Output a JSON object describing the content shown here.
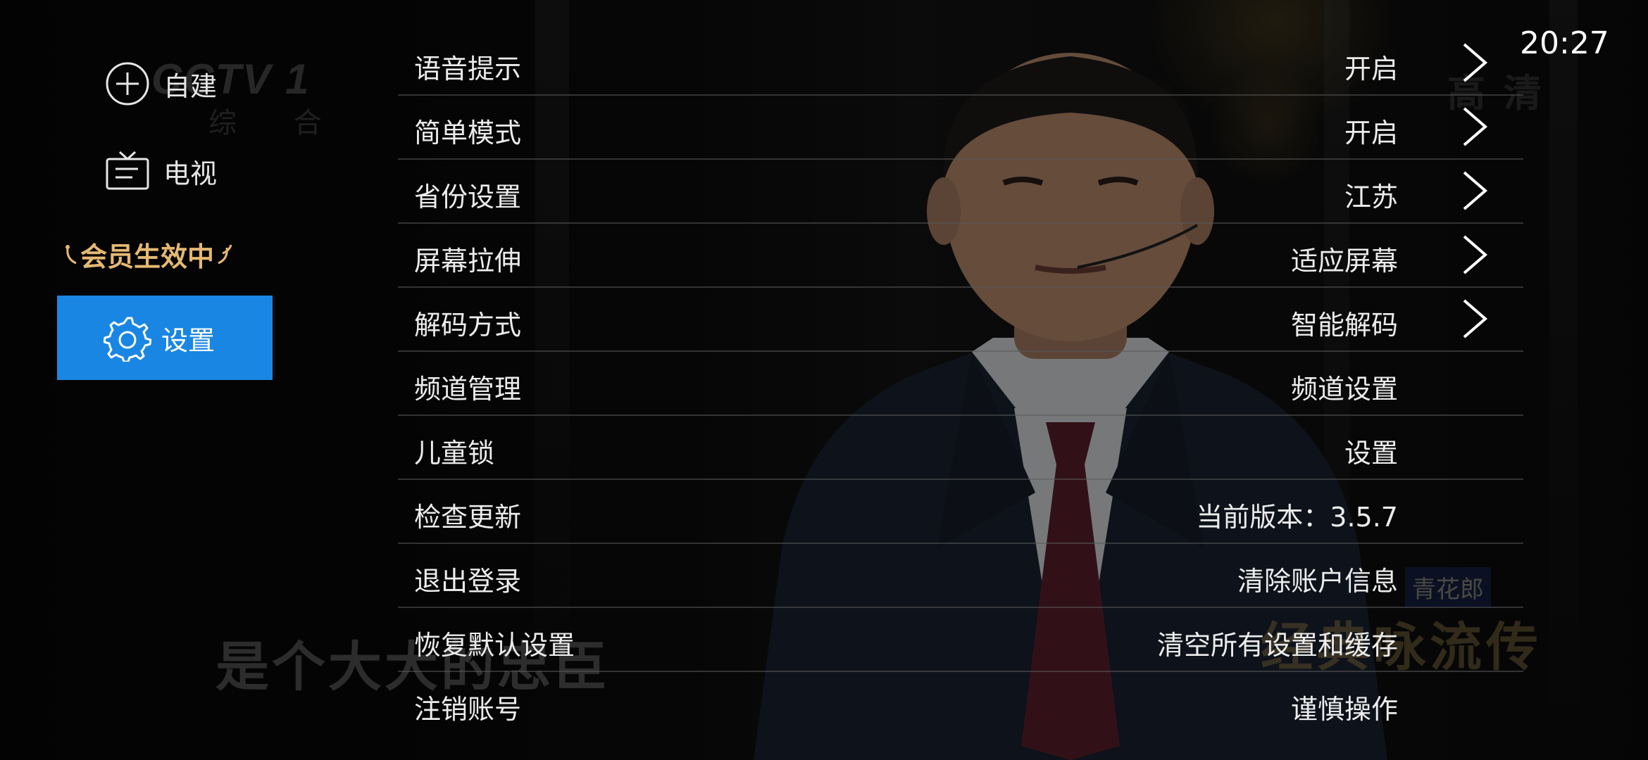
{
  "clock": "20:27",
  "background": {
    "channel_logo": "CCTV 1",
    "channel_sub": "综 合",
    "hd_mark": "高清",
    "subtitle": "是个大大的忠臣",
    "watermark_brand": "青花郎",
    "watermark_show": "经典咏流传"
  },
  "sidebar": {
    "items": [
      {
        "label": "自建",
        "icon": "plus-circle-icon"
      },
      {
        "label": "电视",
        "icon": "tv-icon"
      }
    ],
    "member_badge": "会员生效中",
    "active_item": {
      "label": "设置",
      "icon": "gear-icon"
    }
  },
  "settings": {
    "rows": [
      {
        "label": "语音提示",
        "value": "开启",
        "chevron": true
      },
      {
        "label": "简单模式",
        "value": "开启",
        "chevron": true
      },
      {
        "label": "省份设置",
        "value": "江苏",
        "chevron": true
      },
      {
        "label": "屏幕拉伸",
        "value": "适应屏幕",
        "chevron": true
      },
      {
        "label": "解码方式",
        "value": "智能解码",
        "chevron": true
      },
      {
        "label": "频道管理",
        "value": "频道设置",
        "chevron": false
      },
      {
        "label": "儿童锁",
        "value": "设置",
        "chevron": false
      },
      {
        "label": "检查更新",
        "value": "当前版本：3.5.7",
        "chevron": false
      },
      {
        "label": "退出登录",
        "value": "清除账户信息",
        "chevron": false
      },
      {
        "label": "恢复默认设置",
        "value": "清空所有设置和缓存",
        "chevron": false
      },
      {
        "label": "注销账号",
        "value": "谨慎操作",
        "chevron": false
      }
    ]
  },
  "colors": {
    "accent": "#1a86e3",
    "member_gold": "#e5b873",
    "text": "#ececec"
  }
}
